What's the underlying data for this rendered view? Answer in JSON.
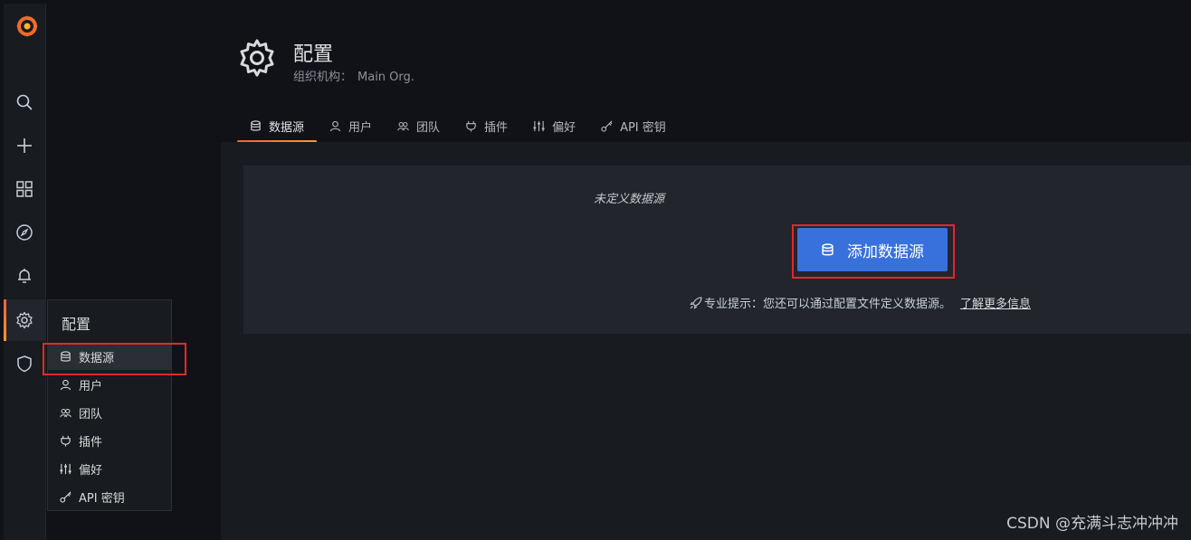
{
  "colors": {
    "brand_orange": "#f46a2a",
    "primary_button": "#3871dc",
    "highlight_red": "#e0292f",
    "background": "#111217"
  },
  "sidebar": {
    "logo": "grafana-logo-icon",
    "items": [
      {
        "icon": "search-icon"
      },
      {
        "icon": "plus-icon"
      },
      {
        "icon": "dashboards-icon"
      },
      {
        "icon": "compass-icon"
      },
      {
        "icon": "bell-icon"
      },
      {
        "icon": "gear-icon",
        "active": true
      },
      {
        "icon": "shield-icon"
      }
    ]
  },
  "popup": {
    "title": "配置",
    "items": [
      {
        "label": "数据源",
        "icon": "database-icon",
        "active": true
      },
      {
        "label": "用户",
        "icon": "user-icon"
      },
      {
        "label": "团队",
        "icon": "users-icon"
      },
      {
        "label": "插件",
        "icon": "plug-icon"
      },
      {
        "label": "偏好",
        "icon": "sliders-icon"
      },
      {
        "label": "API 密钥",
        "icon": "key-icon"
      }
    ]
  },
  "header": {
    "title": "配置",
    "org_label": "组织机构：",
    "org_name": "Main Org."
  },
  "tabs": [
    {
      "label": "数据源",
      "icon": "database-icon",
      "active": true
    },
    {
      "label": "用户",
      "icon": "user-icon"
    },
    {
      "label": "团队",
      "icon": "users-icon"
    },
    {
      "label": "插件",
      "icon": "plug-icon"
    },
    {
      "label": "偏好",
      "icon": "sliders-icon"
    },
    {
      "label": "API 密钥",
      "icon": "key-icon"
    }
  ],
  "empty_state": {
    "title": "未定义数据源",
    "button_label": "添加数据源",
    "tip_text": "专业提示：您还可以通过配置文件定义数据源。",
    "tip_link": "了解更多信息"
  },
  "watermark": "CSDN @充满斗志冲冲冲"
}
